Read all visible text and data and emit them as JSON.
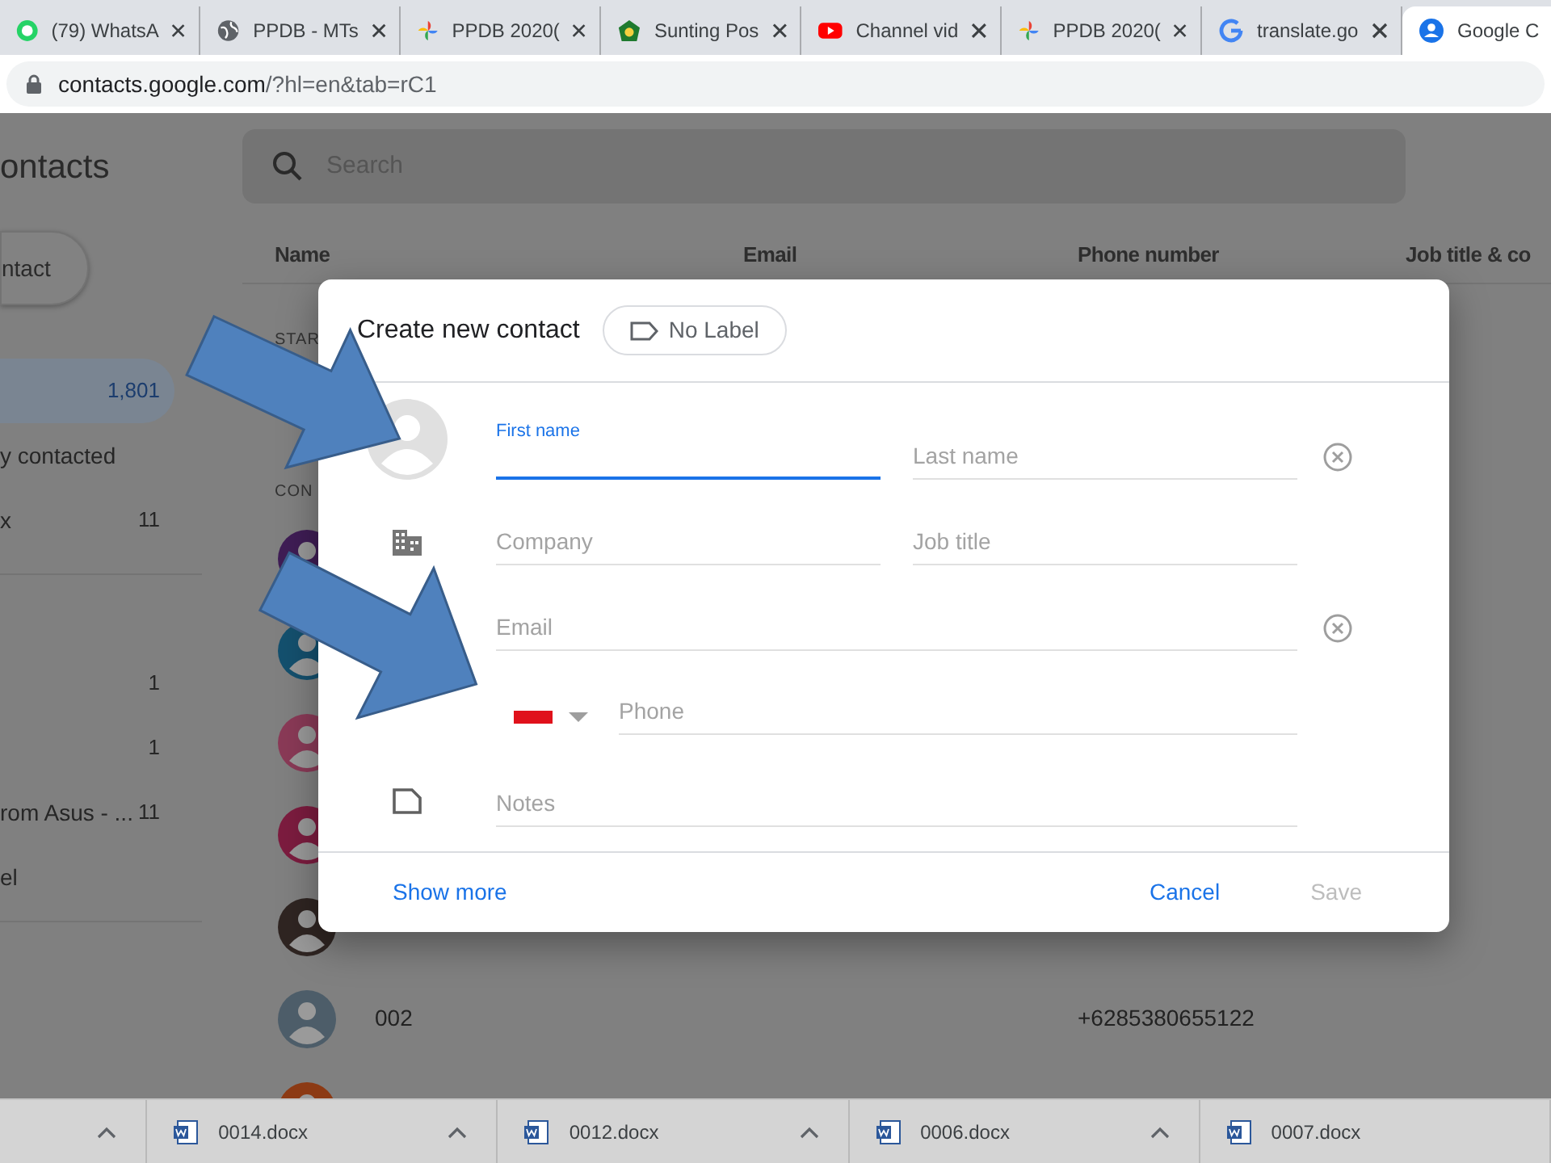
{
  "browser": {
    "tabs": [
      {
        "title": "(79) WhatsA",
        "kind": "chat",
        "selected": false
      },
      {
        "title": "PPDB - MTs",
        "kind": "globe",
        "selected": false
      },
      {
        "title": "PPDB 2020(",
        "kind": "pinwheel",
        "selected": false
      },
      {
        "title": "Sunting Pos",
        "kind": "shield",
        "selected": false
      },
      {
        "title": "Channel vid",
        "kind": "video",
        "selected": false
      },
      {
        "title": "PPDB 2020(",
        "kind": "pinwheel",
        "selected": false
      },
      {
        "title": "translate.go",
        "kind": "search",
        "selected": false
      },
      {
        "title": "Google C",
        "kind": "people",
        "selected": true
      }
    ],
    "url_host": "contacts.google.com",
    "url_path": "/?hl=en&tab=rC1"
  },
  "sidebar": {
    "title": "ontacts",
    "create_button": "ntact",
    "sections": [
      {
        "items": [
          {
            "count": "1,801",
            "selected": true
          },
          {
            "label": "y contacted",
            "selected": false
          },
          {
            "label": "x",
            "count": "11",
            "selected": false
          }
        ]
      },
      {
        "items": [
          {
            "count": "1",
            "selected": false
          },
          {
            "count": "1",
            "selected": false
          },
          {
            "label": "rom Asus - ...",
            "count": "11",
            "selected": false
          },
          {
            "label": "el",
            "selected": false
          }
        ]
      }
    ]
  },
  "search": {
    "placeholder": "Search"
  },
  "table": {
    "columns": [
      "Name",
      "Email",
      "Phone number",
      "Job title & co"
    ],
    "sections": [
      {
        "label": "STAR"
      },
      {
        "label": "CON"
      }
    ],
    "rows": [
      {
        "color": "#3f1d55"
      },
      {
        "color": "#14506e"
      },
      {
        "color": "#8a3a57"
      },
      {
        "color": "#7c1c3f"
      },
      {
        "color": "#2f2522"
      },
      {
        "color": "#4d5d69",
        "name": "002",
        "phone": "+6285380655122"
      },
      {
        "color": "#8c3a14"
      }
    ]
  },
  "dialog": {
    "title": "Create new contact",
    "label_chip": "No Label",
    "first_name": {
      "label": "First name",
      "focused": true
    },
    "last_name": {
      "placeholder": "Last name"
    },
    "company": {
      "placeholder": "Company"
    },
    "job_title": {
      "placeholder": "Job title"
    },
    "email": {
      "placeholder": "Email"
    },
    "phone": {
      "placeholder": "Phone"
    },
    "notes": {
      "placeholder": "Notes"
    },
    "show_more": "Show more",
    "cancel": "Cancel",
    "save": {
      "label": "Save",
      "disabled": true
    }
  },
  "downloads": [
    {
      "file": "0014.docx"
    },
    {
      "file": "0012.docx"
    },
    {
      "file": "0006.docx"
    },
    {
      "file": "0007.docx"
    }
  ]
}
